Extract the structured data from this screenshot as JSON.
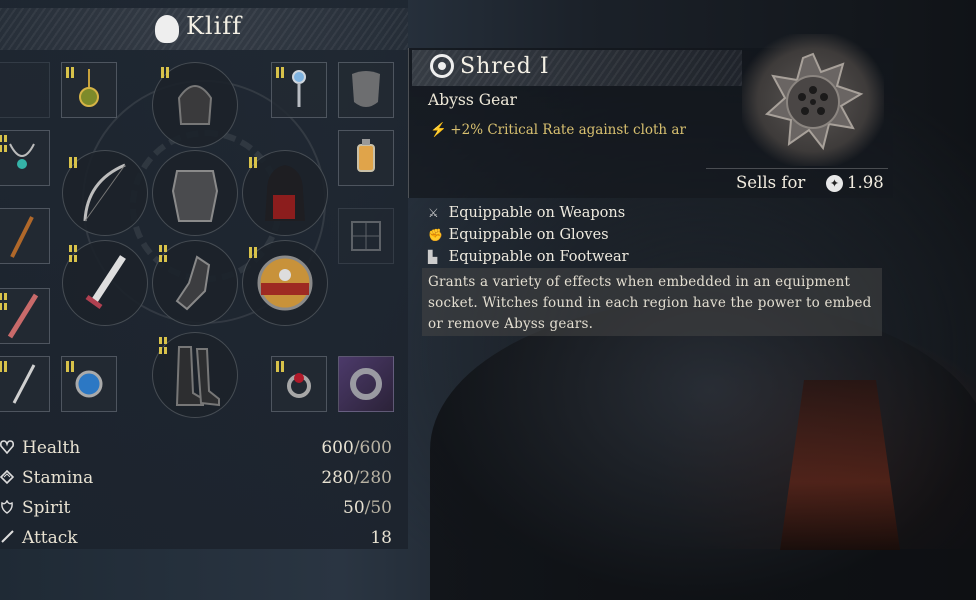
{
  "character": {
    "name": "Kliff"
  },
  "item": {
    "name": "Shred I",
    "type": "Abyss Gear",
    "effect": "+2% Critical Rate against cloth ar",
    "sells_label": "Sells for",
    "sells_value": "1.98",
    "equippable": [
      {
        "icon": "weapons-icon",
        "label": "Equippable on Weapons"
      },
      {
        "icon": "gloves-icon",
        "label": "Equippable on Gloves"
      },
      {
        "icon": "footwear-icon",
        "label": "Equippable on Footwear"
      }
    ],
    "description": "Grants a variety of effects when embedded in an equipment socket. Witches found in each region have the power to embed or remove Abyss gears."
  },
  "stats": [
    {
      "icon": "heart-icon",
      "label": "Health",
      "value": "600",
      "max": "/600"
    },
    {
      "icon": "stamina-icon",
      "label": "Stamina",
      "value": "280",
      "max": "/280"
    },
    {
      "icon": "spirit-icon",
      "label": "Spirit",
      "value": "50",
      "max": "/50"
    },
    {
      "icon": "sword-icon",
      "label": "Attack",
      "value": "18",
      "max": ""
    }
  ],
  "colors": {
    "accent": "#d8c24a",
    "effect_text": "#d8c070"
  }
}
